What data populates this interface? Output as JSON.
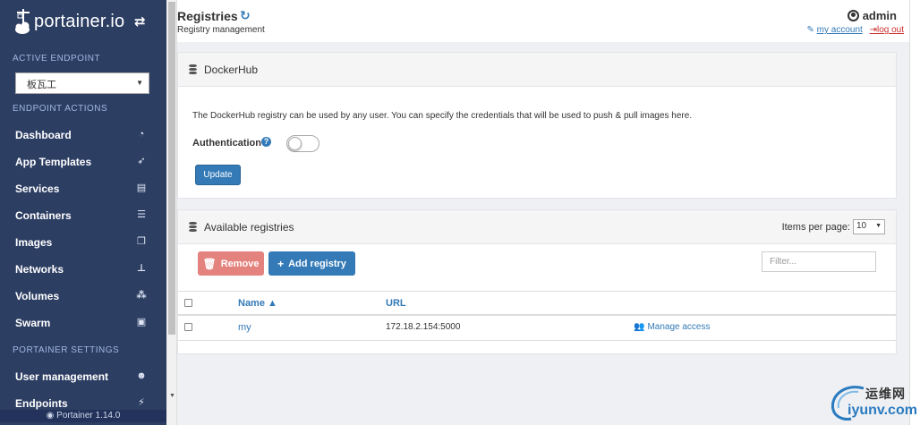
{
  "sidebar": {
    "brand": "portainer.io",
    "active_endpoint_header": "ACTIVE ENDPOINT",
    "endpoint_selected": "板瓦工",
    "endpoint_actions_header": "ENDPOINT ACTIONS",
    "items": [
      {
        "label": "Dashboard",
        "icon": "dashboard-icon"
      },
      {
        "label": "App Templates",
        "icon": "rocket-icon"
      },
      {
        "label": "Services",
        "icon": "list-alt-icon"
      },
      {
        "label": "Containers",
        "icon": "server-icon"
      },
      {
        "label": "Images",
        "icon": "clone-icon"
      },
      {
        "label": "Networks",
        "icon": "sitemap-icon"
      },
      {
        "label": "Volumes",
        "icon": "cubes-icon"
      },
      {
        "label": "Swarm",
        "icon": "object-group-icon"
      }
    ],
    "settings_header": "PORTAINER SETTINGS",
    "settings_items": [
      {
        "label": "User management",
        "icon": "users-icon"
      },
      {
        "label": "Endpoints",
        "icon": "plug-icon"
      }
    ],
    "version": "Portainer 1.14.0"
  },
  "header": {
    "title": "Registries",
    "subtitle": "Registry management",
    "username": "admin",
    "my_account": "my account",
    "log_out": "log out"
  },
  "dockerhub": {
    "title": "DockerHub",
    "description": "The DockerHub registry can be used by any user. You can specify the credentials that will be used to push & pull images here.",
    "auth_label": "Authentication",
    "auth_enabled": false,
    "update_label": "Update"
  },
  "registries": {
    "title": "Available registries",
    "items_per_page_label": "Items per page:",
    "items_per_page": "10",
    "remove_label": "Remove",
    "add_label": "Add registry",
    "filter_placeholder": "Filter...",
    "columns": {
      "name": "Name",
      "url": "URL"
    },
    "rows": [
      {
        "name": "my",
        "url": "172.18.2.154:5000",
        "action": "Manage access"
      }
    ]
  },
  "watermark": {
    "cn": "运维网",
    "en": "iyunv.com"
  },
  "colors": {
    "sidebar": "#2d3e63",
    "primary": "#337ab7",
    "danger": "#e4827d"
  }
}
